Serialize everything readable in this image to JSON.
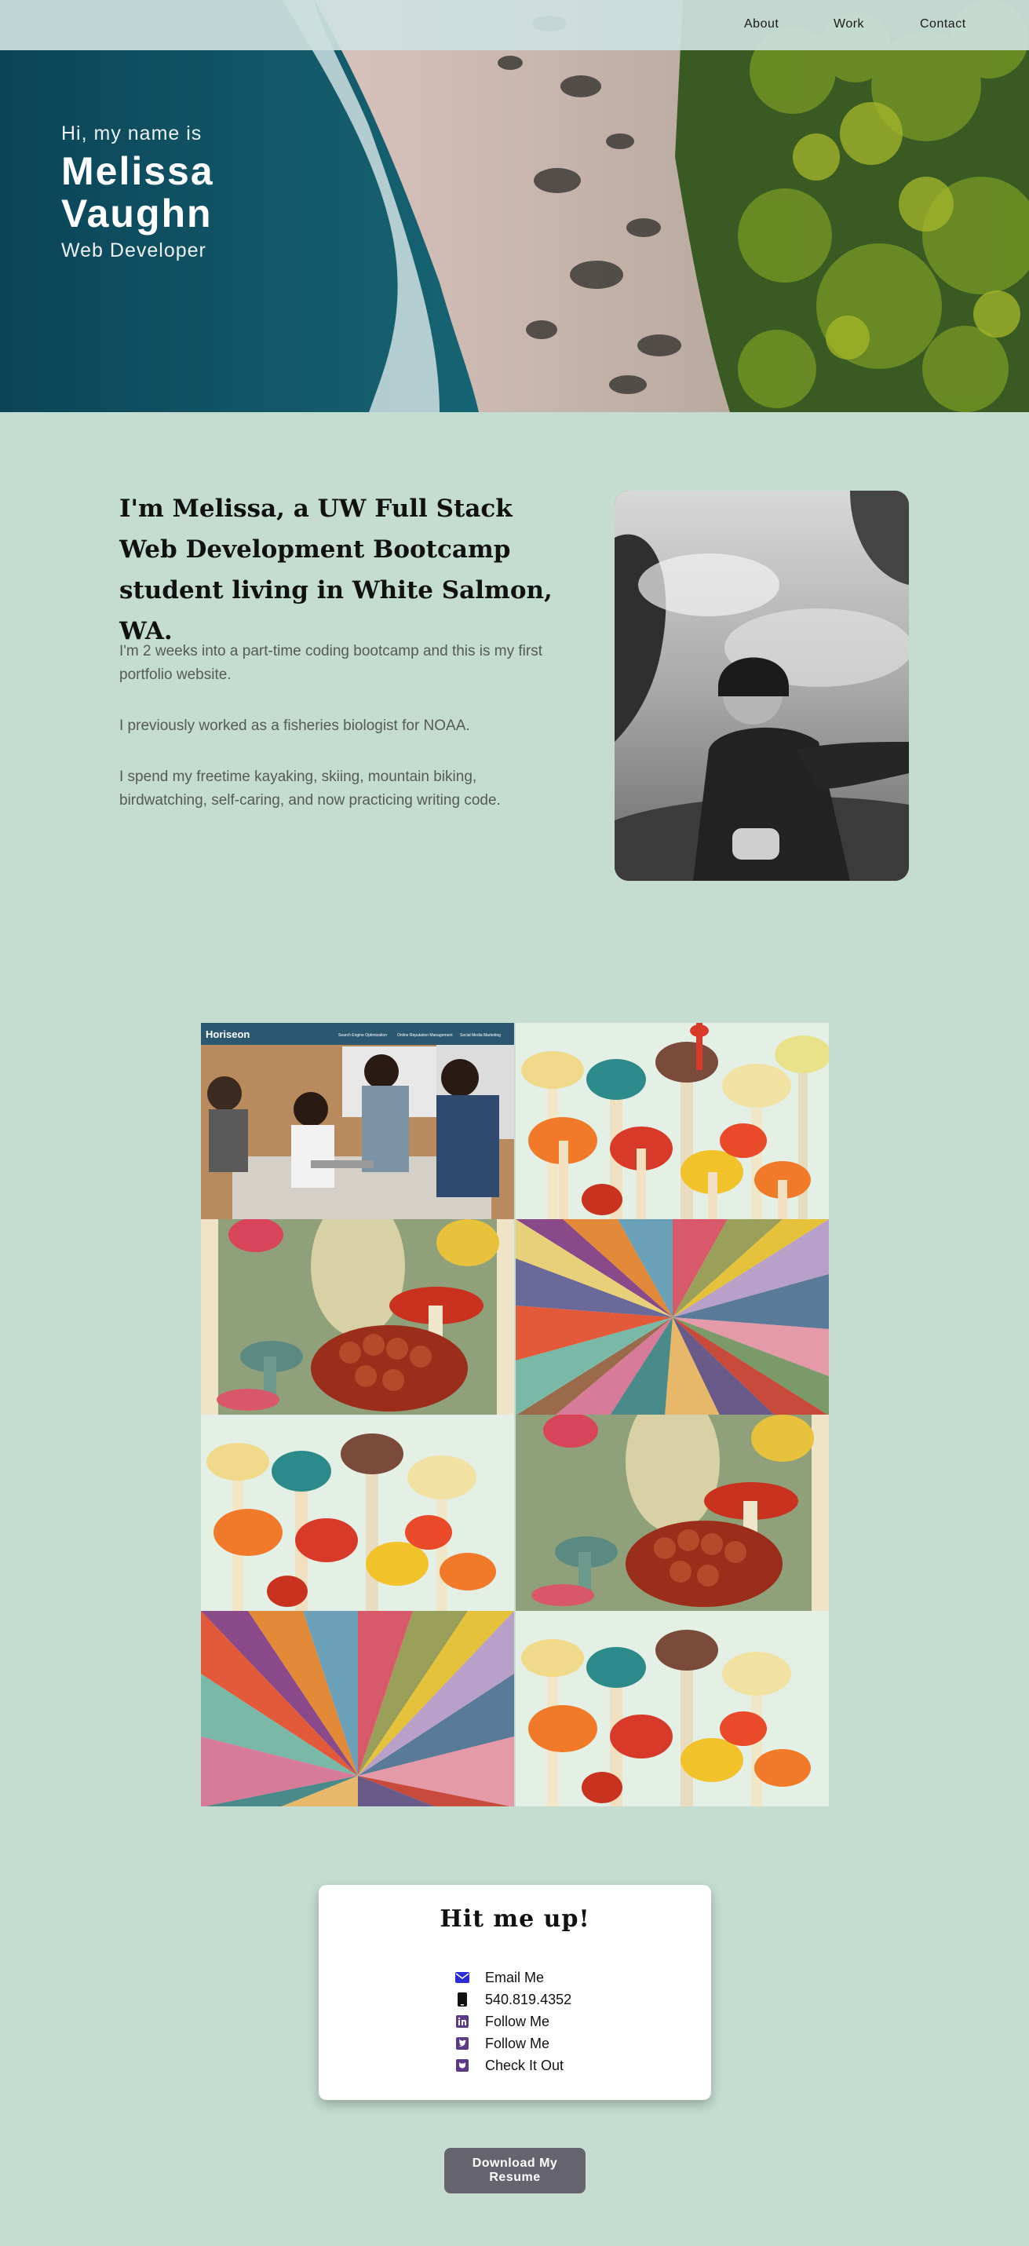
{
  "nav": {
    "links": [
      "About",
      "Work",
      "Contact"
    ]
  },
  "hero": {
    "greeting": "Hi, my name is",
    "name": "Melissa Vaughn",
    "role": "Web Developer"
  },
  "about": {
    "heading": "I'm Melissa, a UW Full Stack Web Development Bootcamp student living in White Salmon, WA.",
    "paragraphs": [
      "I'm 2 weeks into a part-time coding bootcamp and this is my first portfolio website.",
      "I previously worked as a fisheries biologist for NOAA.",
      "I spend my freetime kayaking, skiing, mountain biking, birdwatching, self-caring, and now practicing writing code."
    ]
  },
  "gallery": {
    "horiseon_logo": "Horiseon",
    "horiseon_nav": [
      "Search Engine Optimization",
      "Online Reputation Management",
      "Social Media Marketing"
    ]
  },
  "contact": {
    "title": "Hit me up!",
    "items": [
      {
        "label": "Email Me",
        "icon": "envelope-icon",
        "color": "#2b2bd9"
      },
      {
        "label": "540.819.4352",
        "icon": "phone-icon",
        "color": "#111111"
      },
      {
        "label": "Follow Me",
        "icon": "linkedin-icon",
        "color": "#5b3a8c"
      },
      {
        "label": "Follow Me",
        "icon": "twitter-icon",
        "color": "#5b3a8c"
      },
      {
        "label": "Check It Out",
        "icon": "github-icon",
        "color": "#5b3a8c"
      }
    ]
  },
  "resume": {
    "label": "Download My Resume"
  }
}
